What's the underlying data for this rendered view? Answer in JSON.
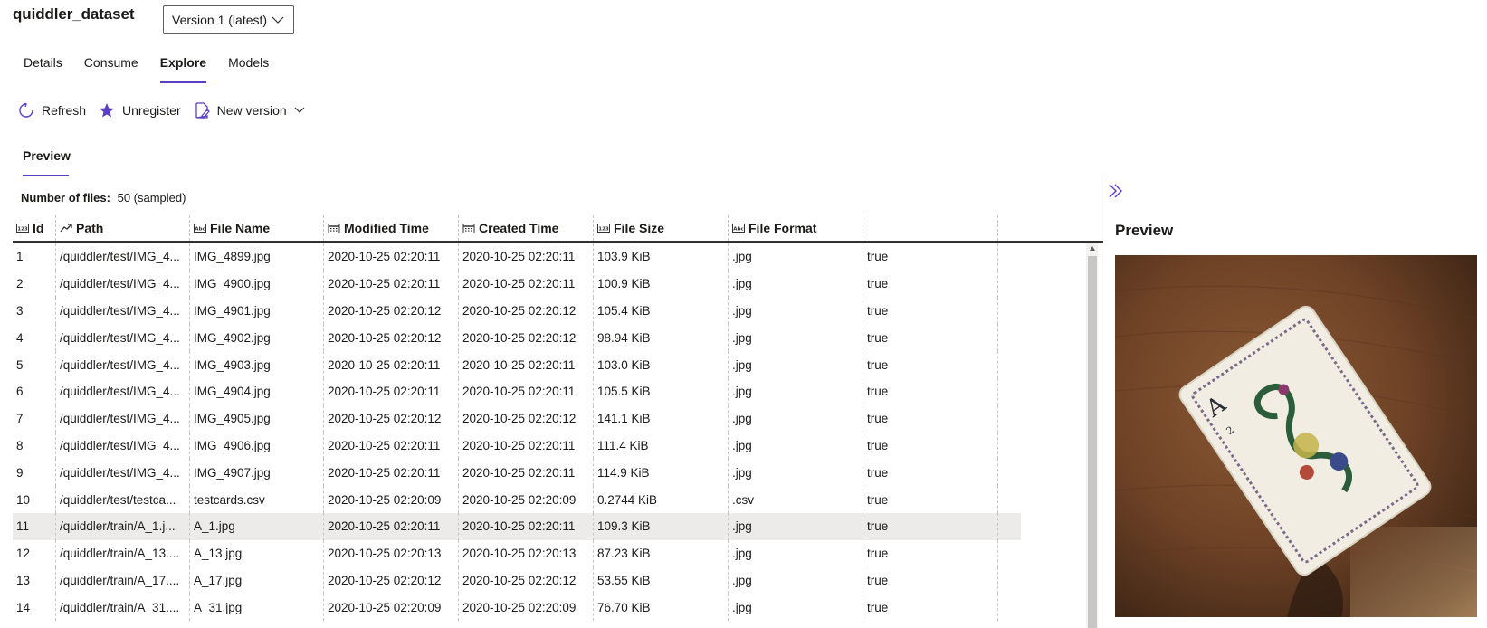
{
  "dataset": {
    "name": "quiddler_dataset",
    "version_selected": "Version 1 (latest)"
  },
  "tabs": [
    {
      "label": "Details"
    },
    {
      "label": "Consume"
    },
    {
      "label": "Explore",
      "active": true
    },
    {
      "label": "Models"
    }
  ],
  "toolbar": {
    "refresh_label": "Refresh",
    "unregister_label": "Unregister",
    "new_version_label": "New version"
  },
  "sub_tab": {
    "label": "Preview"
  },
  "summary": {
    "label": "Number of files:",
    "value": "50 (sampled)"
  },
  "table": {
    "columns": [
      {
        "label": "Id",
        "icon": "numeric-type-icon"
      },
      {
        "label": "Path",
        "icon": "path-type-icon"
      },
      {
        "label": "File Name",
        "icon": "text-type-icon"
      },
      {
        "label": "Modified Time",
        "icon": "calendar-icon"
      },
      {
        "label": "Created Time",
        "icon": "calendar-icon"
      },
      {
        "label": "File Size",
        "icon": "numeric-type-icon"
      },
      {
        "label": "File Format",
        "icon": "text-type-icon"
      },
      {
        "label": "",
        "icon": ""
      }
    ],
    "rows": [
      [
        "1",
        "/quiddler/test/IMG_4...",
        "IMG_4899.jpg",
        "2020-10-25 02:20:11",
        "2020-10-25 02:20:11",
        "103.9 KiB",
        ".jpg",
        "true"
      ],
      [
        "2",
        "/quiddler/test/IMG_4...",
        "IMG_4900.jpg",
        "2020-10-25 02:20:11",
        "2020-10-25 02:20:11",
        "100.9 KiB",
        ".jpg",
        "true"
      ],
      [
        "3",
        "/quiddler/test/IMG_4...",
        "IMG_4901.jpg",
        "2020-10-25 02:20:12",
        "2020-10-25 02:20:12",
        "105.4 KiB",
        ".jpg",
        "true"
      ],
      [
        "4",
        "/quiddler/test/IMG_4...",
        "IMG_4902.jpg",
        "2020-10-25 02:20:12",
        "2020-10-25 02:20:12",
        "98.94 KiB",
        ".jpg",
        "true"
      ],
      [
        "5",
        "/quiddler/test/IMG_4...",
        "IMG_4903.jpg",
        "2020-10-25 02:20:11",
        "2020-10-25 02:20:11",
        "103.0 KiB",
        ".jpg",
        "true"
      ],
      [
        "6",
        "/quiddler/test/IMG_4...",
        "IMG_4904.jpg",
        "2020-10-25 02:20:11",
        "2020-10-25 02:20:11",
        "105.5 KiB",
        ".jpg",
        "true"
      ],
      [
        "7",
        "/quiddler/test/IMG_4...",
        "IMG_4905.jpg",
        "2020-10-25 02:20:12",
        "2020-10-25 02:20:12",
        "141.1 KiB",
        ".jpg",
        "true"
      ],
      [
        "8",
        "/quiddler/test/IMG_4...",
        "IMG_4906.jpg",
        "2020-10-25 02:20:11",
        "2020-10-25 02:20:11",
        "111.4 KiB",
        ".jpg",
        "true"
      ],
      [
        "9",
        "/quiddler/test/IMG_4...",
        "IMG_4907.jpg",
        "2020-10-25 02:20:11",
        "2020-10-25 02:20:11",
        "114.9 KiB",
        ".jpg",
        "true"
      ],
      [
        "10",
        "/quiddler/test/testca...",
        "testcards.csv",
        "2020-10-25 02:20:09",
        "2020-10-25 02:20:09",
        "0.2744 KiB",
        ".csv",
        "true"
      ],
      [
        "11",
        "/quiddler/train/A_1.j...",
        "A_1.jpg",
        "2020-10-25 02:20:11",
        "2020-10-25 02:20:11",
        "109.3 KiB",
        ".jpg",
        "true"
      ],
      [
        "12",
        "/quiddler/train/A_13....",
        "A_13.jpg",
        "2020-10-25 02:20:13",
        "2020-10-25 02:20:13",
        "87.23 KiB",
        ".jpg",
        "true"
      ],
      [
        "13",
        "/quiddler/train/A_17....",
        "A_17.jpg",
        "2020-10-25 02:20:12",
        "2020-10-25 02:20:12",
        "53.55 KiB",
        ".jpg",
        "true"
      ],
      [
        "14",
        "/quiddler/train/A_31....",
        "A_31.jpg",
        "2020-10-25 02:20:09",
        "2020-10-25 02:20:09",
        "76.70 KiB",
        ".jpg",
        "true"
      ]
    ],
    "selected_row": 11
  },
  "preview_panel": {
    "title": "Preview",
    "image": "playing-card-photo",
    "card_letter": "A",
    "card_number": "2"
  },
  "colors": {
    "accent": "#5b3fc5",
    "selected_row": "#edebe9",
    "text": "#1b1a19"
  }
}
